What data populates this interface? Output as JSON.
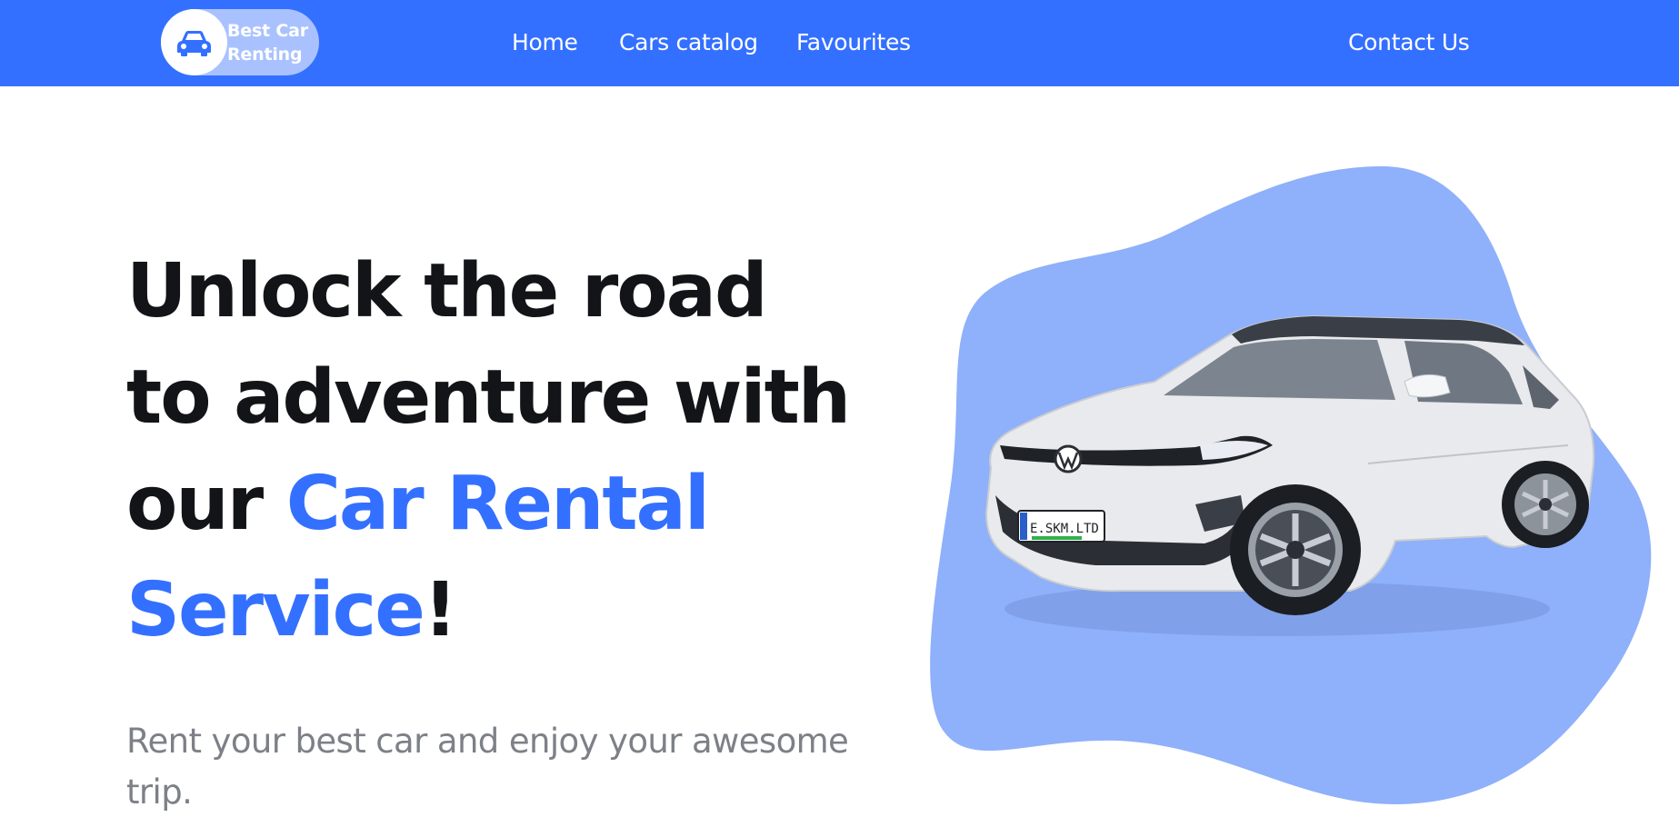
{
  "header": {
    "logo_line1": "Best Car",
    "logo_line2": "Renting",
    "logo_icon": "car-icon",
    "nav": {
      "home": "Home",
      "catalog": "Cars catalog",
      "favourites": "Favourites",
      "contact": "Contact Us"
    }
  },
  "hero": {
    "title_line1": "Unlock the road",
    "title_line2": "to adventure with",
    "title_line3_prefix": "our ",
    "title_line3_accent": "Car Rental",
    "title_line4_accent": "Service",
    "title_line4_suffix": "!",
    "subtitle_line1": "Rent your best car and enjoy your awesome",
    "subtitle_line2": "trip."
  },
  "car": {
    "plate": "E.SKM.LTD"
  },
  "colors": {
    "brand_blue": "#3470ff",
    "blob_blue": "#8fb0fa",
    "title_dark": "#121417",
    "subtitle_gray": "#7d8087"
  }
}
